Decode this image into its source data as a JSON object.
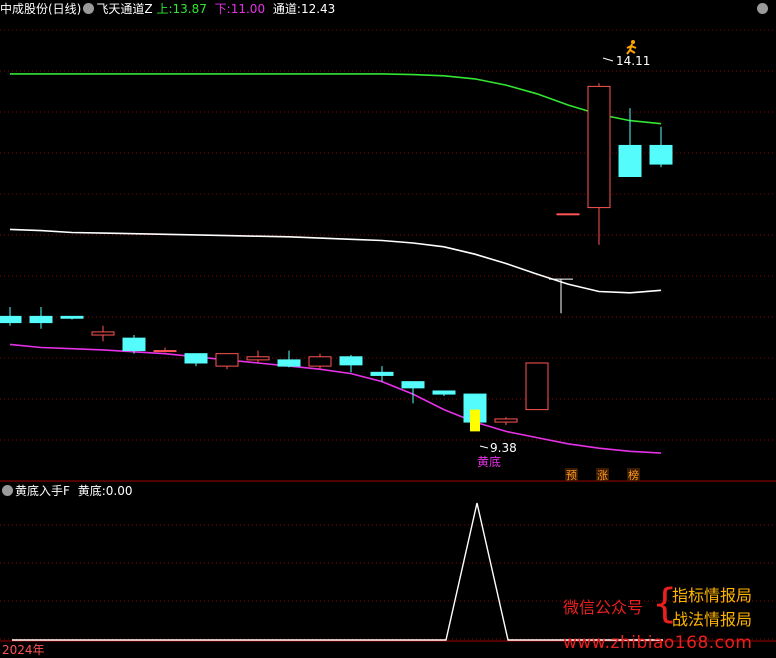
{
  "header": {
    "stock_name": "中成股份(日线)",
    "indicator_name": "飞天通道Z",
    "upper_label": "上:",
    "upper_value": "13.87",
    "lower_label": "下:",
    "lower_value": "11.00",
    "channel_label": "通道:",
    "channel_value": "12.43"
  },
  "sub_header": {
    "indicator_name": "黄底入手F",
    "label": "黄底:",
    "value": "0.00"
  },
  "annotations": {
    "high_price": "14.11",
    "low_price": "9.38",
    "bottom_signal": "黄底",
    "tags": [
      "预",
      "涨",
      "榜"
    ]
  },
  "footer": {
    "year": "2024年"
  },
  "watermark": {
    "left_text": "微信公众号",
    "right_top": "指标情报局",
    "right_bottom": "战法情报局",
    "url": "www.zhibiao168.com"
  },
  "colors": {
    "up": "#ff5454",
    "down": "#54fcfc",
    "upper_line": "#32e632",
    "lower_line": "#ffffff",
    "mid_line": "#e632e6",
    "signal_bar": "#ffff00",
    "grid": "#8b0000"
  },
  "chart_data": [
    {
      "type": "candlestick",
      "title": "中成股份(日线)",
      "price_axis_ticks_shown": false,
      "candles": [
        {
          "open": 9.8,
          "close": 9.7,
          "high": 9.95,
          "low": 9.65
        },
        {
          "open": 9.8,
          "close": 9.7,
          "high": 9.95,
          "low": 9.6
        },
        {
          "open": 9.8,
          "close": 9.77,
          "high": 9.8,
          "low": 9.75
        },
        {
          "open": 9.5,
          "close": 9.55,
          "high": 9.65,
          "low": 9.4
        },
        {
          "open": 9.45,
          "close": 9.25,
          "high": 9.5,
          "low": 9.2
        },
        {
          "open": 9.25,
          "close": 9.25,
          "high": 9.3,
          "low": 9.22
        },
        {
          "open": 9.2,
          "close": 9.05,
          "high": 9.2,
          "low": 9.0
        },
        {
          "open": 9.0,
          "close": 9.2,
          "high": 9.2,
          "low": 8.95
        },
        {
          "open": 9.1,
          "close": 9.15,
          "high": 9.25,
          "low": 9.05
        },
        {
          "open": 9.1,
          "close": 9.0,
          "high": 9.25,
          "low": 8.98
        },
        {
          "open": 9.0,
          "close": 9.15,
          "high": 9.2,
          "low": 8.95
        },
        {
          "open": 9.15,
          "close": 9.02,
          "high": 9.18,
          "low": 8.9
        },
        {
          "open": 8.9,
          "close": 8.85,
          "high": 9.0,
          "low": 8.75
        },
        {
          "open": 8.75,
          "close": 8.65,
          "high": 8.75,
          "low": 8.4
        },
        {
          "open": 8.6,
          "close": 8.55,
          "high": 8.6,
          "low": 8.52
        },
        {
          "open": 8.55,
          "close": 8.1,
          "high": 8.55,
          "low": 8.05
        },
        {
          "open": 8.1,
          "close": 8.15,
          "high": 8.18,
          "low": 8.05
        },
        {
          "open": 8.3,
          "close": 9.05,
          "high": 9.05,
          "low": 8.3
        },
        {
          "open": 11.45,
          "close": 11.45,
          "high": 11.45,
          "low": 11.45
        },
        {
          "open": 11.55,
          "close": 13.5,
          "high": 13.55,
          "low": 10.95
        },
        {
          "open": 12.55,
          "close": 12.05,
          "high": 13.15,
          "low": 12.05
        },
        {
          "open": 12.55,
          "close": 12.25,
          "high": 12.85,
          "low": 12.2
        }
      ],
      "gap_candle": {
        "open": 10.4,
        "close": 10.4,
        "high": 10.4,
        "low": 9.85
      },
      "signal_bar": {
        "index": 15,
        "top": 8.3,
        "bottom": 7.95
      },
      "series": [
        {
          "name": "上",
          "values": [
            null,
            null,
            null,
            null,
            null,
            null,
            null,
            null,
            null,
            null,
            null,
            null,
            null,
            null,
            null,
            null,
            null,
            null,
            null,
            12.75,
            12.85,
            13.0
          ]
        },
        {
          "name": "下",
          "values": [
            null,
            null,
            null,
            null,
            null,
            null,
            null,
            null,
            null,
            null,
            null,
            null,
            null,
            null,
            null,
            null,
            null,
            null,
            null,
            10.5,
            10.55,
            10.58
          ]
        },
        {
          "name": "通道",
          "values": [
            9.35,
            9.3,
            9.28,
            9.26,
            9.23,
            9.2,
            9.15,
            9.1,
            9.05,
            9.0,
            8.95,
            8.88,
            8.75,
            8.55,
            8.3,
            8.1,
            7.95,
            7.85,
            7.75,
            7.68,
            7.63,
            7.6
          ]
        }
      ],
      "upper_history": [
        13.7,
        13.7,
        13.7,
        13.7,
        13.7,
        13.7,
        13.7,
        13.7,
        13.7,
        13.7,
        13.7,
        13.7,
        13.7,
        13.69,
        13.67,
        13.62,
        13.52,
        13.38,
        13.2,
        13.05,
        12.95,
        12.9
      ],
      "lower_history": [
        11.2,
        11.18,
        11.15,
        11.14,
        11.13,
        11.12,
        11.11,
        11.1,
        11.09,
        11.08,
        11.06,
        11.04,
        11.02,
        10.98,
        10.92,
        10.8,
        10.65,
        10.48,
        10.32,
        10.2,
        10.18,
        10.22
      ]
    },
    {
      "type": "line",
      "title": "黄底入手F",
      "series": [
        {
          "name": "黄底",
          "values": [
            0,
            0,
            0,
            0,
            0,
            0,
            0,
            0,
            0,
            0,
            0,
            0,
            0,
            0,
            0,
            1,
            0,
            0,
            0,
            0,
            0,
            0
          ]
        }
      ],
      "ylim": [
        0,
        1
      ]
    }
  ]
}
